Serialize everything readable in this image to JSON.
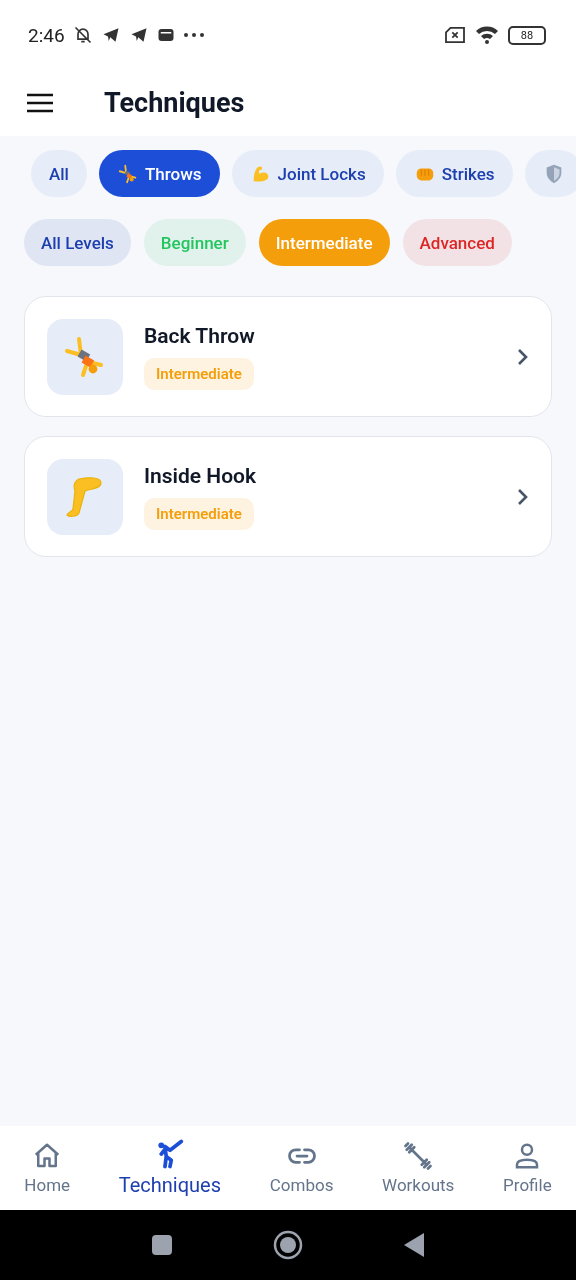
{
  "status_bar": {
    "time": "2:46",
    "battery": "88"
  },
  "header": {
    "title": "Techniques"
  },
  "categories": [
    {
      "label": "All",
      "kind": "plain",
      "selected": false
    },
    {
      "label": "Throws",
      "kind": "cartwheel",
      "selected": true
    },
    {
      "label": "Joint Locks",
      "kind": "muscle",
      "selected": false
    },
    {
      "label": "Strikes",
      "kind": "fist",
      "selected": false
    },
    {
      "kind": "shield",
      "selected": false
    }
  ],
  "levels": [
    {
      "label": "All Levels",
      "color": "#1e40af",
      "selected": false
    },
    {
      "label": "Beginner",
      "color": "#22c55e",
      "selected": false
    },
    {
      "label": "Intermediate",
      "color": "#f59e0b",
      "selected": true
    },
    {
      "label": "Advanced",
      "color": "#dc2626",
      "selected": false
    }
  ],
  "techniques": [
    {
      "name": "Back Throw",
      "kind": "cartwheel",
      "level": "Intermediate",
      "color": "#f59e0b"
    },
    {
      "name": "Inside Hook",
      "kind": "leg",
      "level": "Intermediate",
      "color": "#f59e0b"
    }
  ],
  "nav": [
    {
      "label": "Home",
      "kind": "home",
      "selected": false
    },
    {
      "label": "Techniques",
      "kind": "kick",
      "selected": true
    },
    {
      "label": "Combos",
      "kind": "link",
      "selected": false
    },
    {
      "label": "Workouts",
      "kind": "dumbbell",
      "selected": false
    },
    {
      "label": "Profile",
      "kind": "person",
      "selected": false
    }
  ]
}
